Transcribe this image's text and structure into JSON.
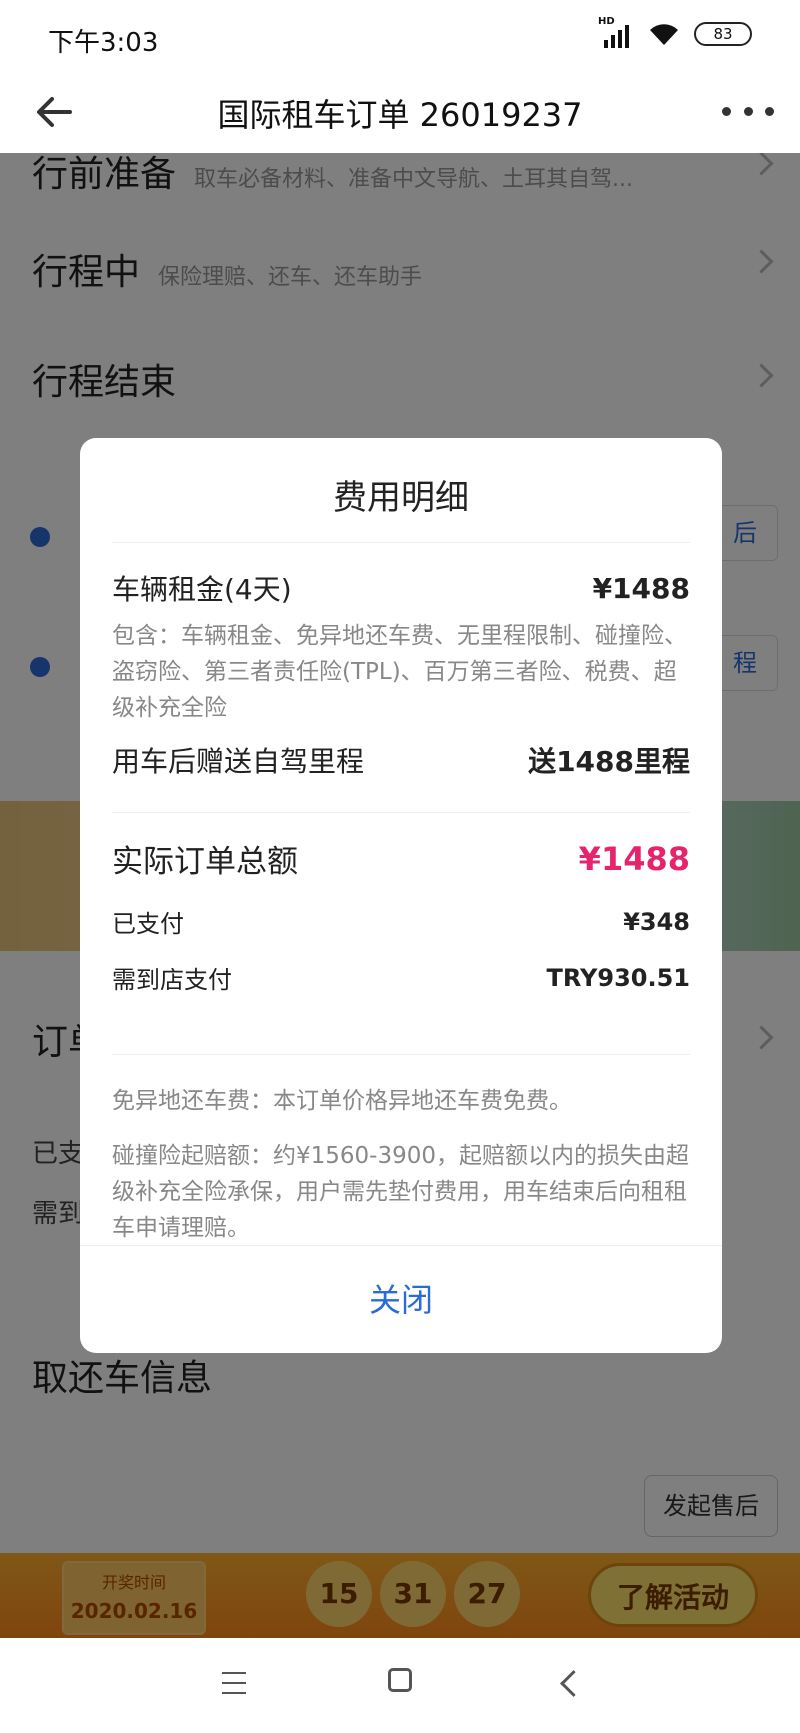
{
  "status_bar": {
    "time": "下午3:03",
    "network": "HD",
    "battery": "83"
  },
  "header": {
    "title": "国际租车订单 26019237"
  },
  "background": {
    "sections": [
      {
        "title": "行前准备",
        "subtitle": "取车必备材料、准备中文导航、土耳其自驾..."
      },
      {
        "title": "行程中",
        "subtitle": "保险理赔、还车、还车助手"
      },
      {
        "title": "行程结束",
        "subtitle": ""
      }
    ],
    "right_pill_1": "后",
    "right_pill_2": "程",
    "order_section_partial": "订单",
    "paid_partial": "已支",
    "due_partial": "需到",
    "pickup_return": "取还车信息",
    "after_sale_button": "发起售后",
    "promo": {
      "draw_time_label": "开奖时间",
      "draw_date": "2020.02.16",
      "countdown": [
        "15",
        "31",
        "27"
      ],
      "learn_button": "了解活动"
    }
  },
  "modal": {
    "title": "费用明细",
    "rental": {
      "label": "车辆租金(4天)",
      "value": "¥1488"
    },
    "includes": "包含：车辆租金、免异地还车费、无里程限制、碰撞险、盗窃险、第三者责任险(TPL)、百万第三者险、税费、超级补充全险",
    "mileage": {
      "label": "用车后赠送自驾里程",
      "value": "送1488里程"
    },
    "total": {
      "label": "实际订单总额",
      "value": "¥1488"
    },
    "paid": {
      "label": "已支付",
      "value": "¥348"
    },
    "due": {
      "label": "需到店支付",
      "value": "TRY930.51"
    },
    "note1": "免异地还车费：本订单价格异地还车费免费。",
    "note2": "碰撞险起赔额：约¥1560-3900，起赔额以内的损失由超级补充全险承保，用户需先垫付费用，用车结束后向租租车申请理赔。",
    "close_label": "关闭"
  },
  "colors": {
    "accent_blue": "#2a6bd6",
    "total_pink": "#e6246e"
  }
}
